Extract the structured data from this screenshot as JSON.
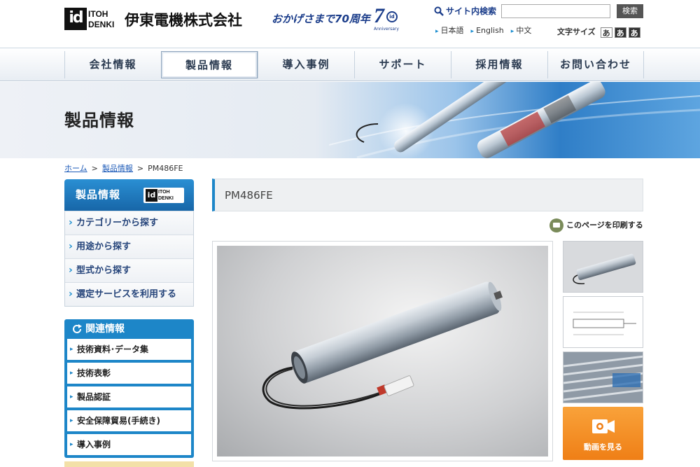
{
  "header": {
    "logo_id": "id",
    "logo_line1": "ITOH",
    "logo_line2": "DENKI",
    "company_name": "伊東電機株式会社",
    "anniversary_text": "おかげさまで70周年",
    "anniversary_badge_number": "7",
    "anniversary_badge_ring": "id",
    "anniversary_badge_label": "Anniversary",
    "search_label": "サイト内検索",
    "search_value": "",
    "search_button": "検索",
    "languages": [
      "日本語",
      "English",
      "中文"
    ],
    "fontsize_label": "文字サイズ",
    "fontsize_options": [
      "あ",
      "あ",
      "あ"
    ]
  },
  "nav": {
    "items": [
      "会社情報",
      "製品情報",
      "導入事例",
      "サポート",
      "採用情報",
      "お問い合わせ"
    ],
    "active_index": 1
  },
  "hero": {
    "title": "製品情報"
  },
  "breadcrumb": {
    "home": "ホーム",
    "sep1": ">",
    "category": "製品情報",
    "sep2": ">",
    "current": "PM486FE"
  },
  "sidebar": {
    "title": "製品情報",
    "logo_id": "id",
    "logo_line1": "ITOH",
    "logo_line2": "DENKI",
    "menu": [
      "カテゴリーから探す",
      "用途から探す",
      "型式から探す",
      "選定サービスを利用する"
    ],
    "related_title": "関連情報",
    "related": [
      "技術資料･データ集",
      "技術表彰",
      "製品認証",
      "安全保障貿易(手続き)",
      "導入事例"
    ]
  },
  "main": {
    "page_title": "PM486FE",
    "print_label": "このページを印刷する",
    "video_label": "動画を見る"
  },
  "colors": {
    "brand_blue": "#1d86c8",
    "nav_text": "#2a3a50",
    "link": "#1e5bb8",
    "video_orange": "#ef7f16"
  }
}
